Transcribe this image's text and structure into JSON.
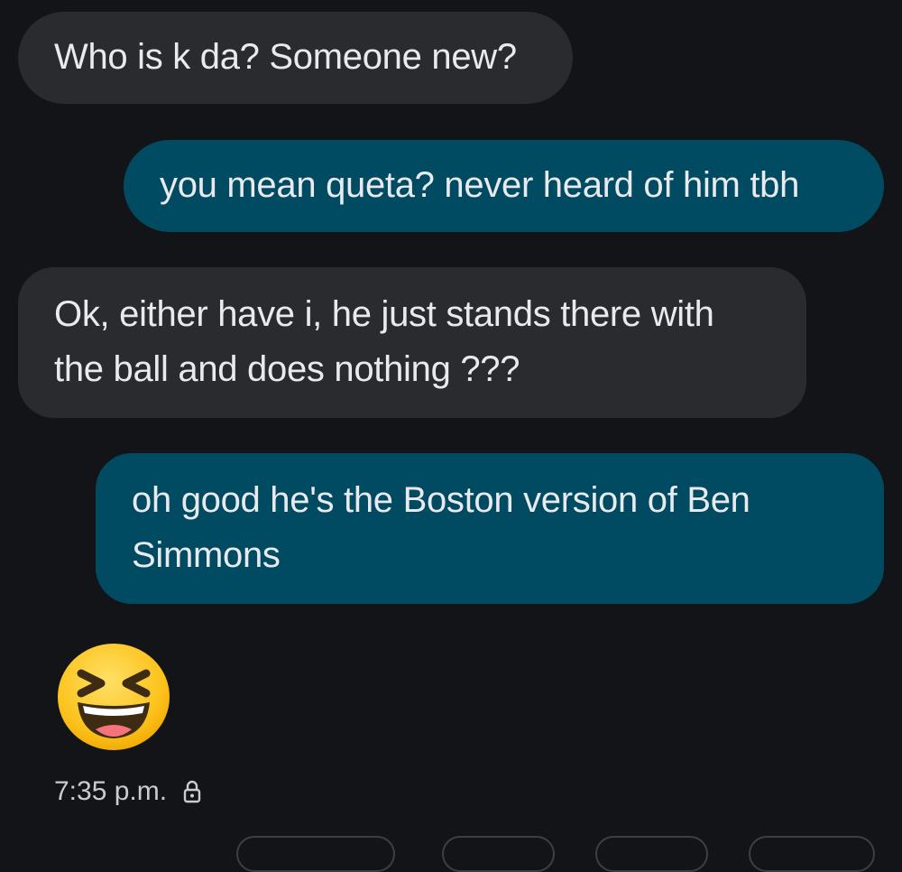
{
  "conversation": {
    "messages": [
      {
        "direction": "incoming",
        "text": "Who is k da? Someone new?"
      },
      {
        "direction": "outgoing",
        "text": "you mean queta? never heard of him tbh"
      },
      {
        "direction": "incoming",
        "text": "Ok, either have i, he just stands there with\nthe ball and does nothing ???"
      },
      {
        "direction": "outgoing",
        "text": "oh good he's the Boston version of Ben\nSimmons"
      }
    ],
    "emoji_reply": {
      "emoji": "grinning-squinting-face",
      "direction": "incoming"
    },
    "last_timestamp": "7:35 p.m.",
    "encryption_icon": "lock-icon"
  },
  "colors": {
    "background": "#121417",
    "incoming_bubble": "#2a2b2f",
    "outgoing_bubble": "#004a62",
    "text": "#e8eaed"
  }
}
